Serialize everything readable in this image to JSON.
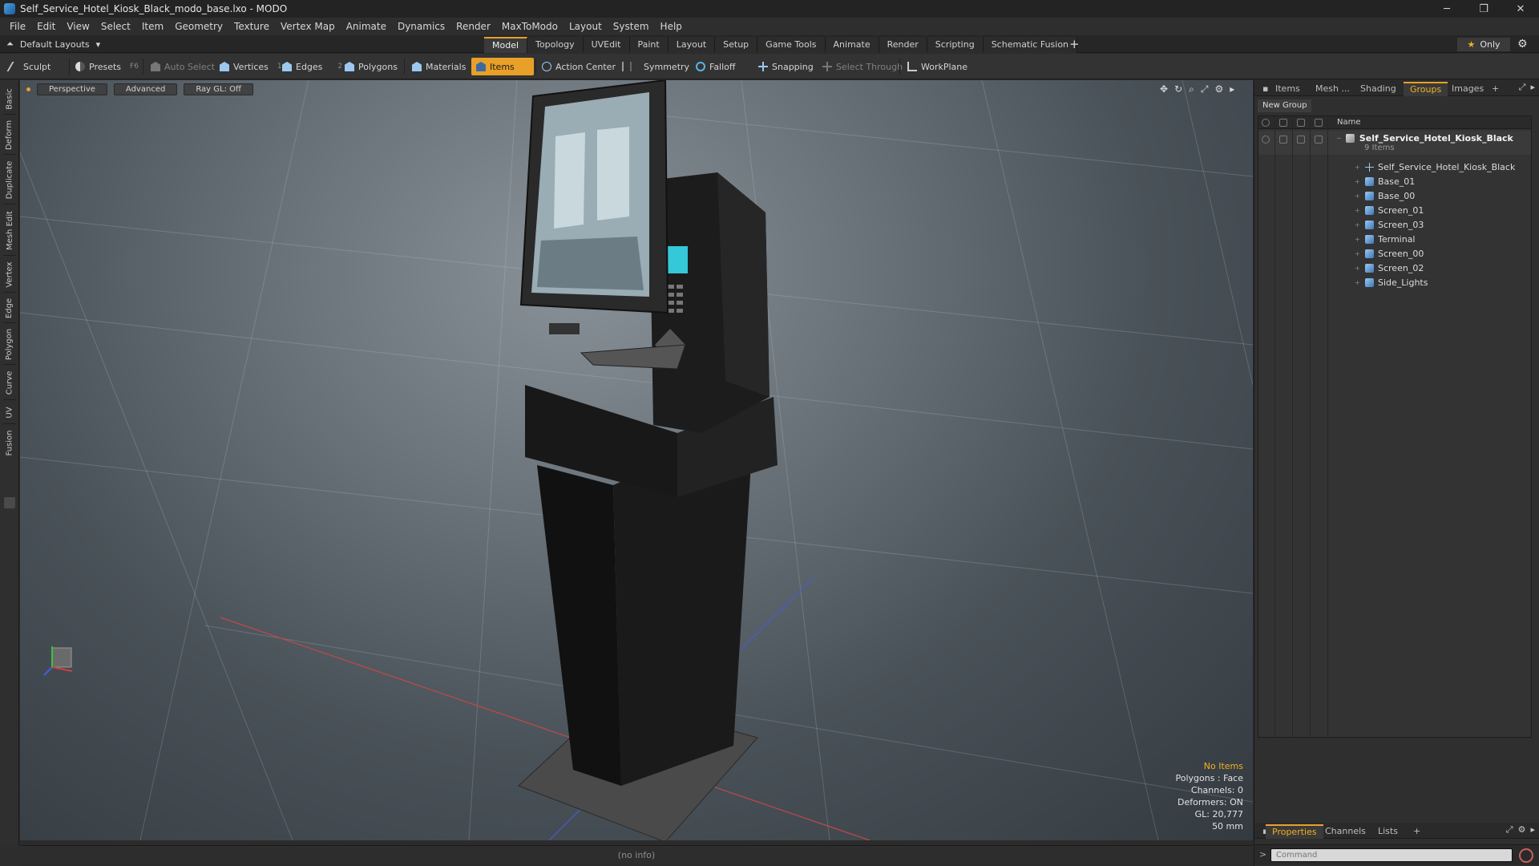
{
  "window": {
    "title": "Self_Service_Hotel_Kiosk_Black_modo_base.lxo - MODO",
    "minimize": "─",
    "maximize": "❐",
    "close": "✕"
  },
  "menu": [
    "File",
    "Edit",
    "View",
    "Select",
    "Item",
    "Geometry",
    "Texture",
    "Vertex Map",
    "Animate",
    "Dynamics",
    "Render",
    "MaxToModo",
    "Layout",
    "System",
    "Help"
  ],
  "layout_bar": {
    "layout_select": "Default Layouts",
    "tabs": [
      "Model",
      "Topology",
      "UVEdit",
      "Paint",
      "Layout",
      "Setup",
      "Game Tools",
      "Animate",
      "Render",
      "Scripting",
      "Schematic Fusion"
    ],
    "active_tab": "Model",
    "plus": "+",
    "only_label": "Only",
    "gear": "⚙"
  },
  "toolbar": {
    "sculpt": "Sculpt",
    "presets": "Presets",
    "presets_key": "F6",
    "auto_select": "Auto Select",
    "vertices": "Vertices",
    "vertices_key": "1",
    "edges": "Edges",
    "edges_key": "2",
    "polygons": "Polygons",
    "materials": "Materials",
    "items": "Items",
    "action_center": "Action Center",
    "symmetry": "Symmetry",
    "falloff": "Falloff",
    "snapping": "Snapping",
    "select_through": "Select Through",
    "workplane": "WorkPlane"
  },
  "left_tabs": [
    "Basic",
    "Deform",
    "Duplicate",
    "Mesh Edit",
    "Vertex",
    "Edge",
    "Polygon",
    "Curve",
    "UV",
    "Fusion"
  ],
  "viewport": {
    "view_mode": "Perspective",
    "shading": "Advanced",
    "raygl": "Ray GL: Off",
    "info": {
      "no_items": "No Items",
      "polygons": "Polygons : Face",
      "channels": "Channels: 0",
      "deformers": "Deformers: ON",
      "gl": "GL: 20,777",
      "focal": "50 mm"
    }
  },
  "status": "(no info)",
  "right_panel": {
    "top_tabs": [
      "Items",
      "Mesh ...",
      "Shading",
      "Groups",
      "Images"
    ],
    "active_top_tab": "Groups",
    "new_group": "New Group",
    "name_col": "Name",
    "group": {
      "name": "Self_Service_Hotel_Kiosk_Black",
      "count": "9 Items",
      "items": [
        {
          "name": "Self_Service_Hotel_Kiosk_Black",
          "type": "locator"
        },
        {
          "name": "Base_01",
          "type": "mesh"
        },
        {
          "name": "Base_00",
          "type": "mesh"
        },
        {
          "name": "Screen_01",
          "type": "mesh"
        },
        {
          "name": "Screen_03",
          "type": "mesh"
        },
        {
          "name": "Terminal",
          "type": "mesh"
        },
        {
          "name": "Screen_00",
          "type": "mesh"
        },
        {
          "name": "Screen_02",
          "type": "mesh"
        },
        {
          "name": "Side_Lights",
          "type": "mesh"
        }
      ]
    },
    "bottom_tabs": [
      "Properties",
      "Channels",
      "Lists"
    ],
    "active_bottom_tab": "Properties",
    "command_placeholder": "Command"
  },
  "colors": {
    "accent": "#e8a029",
    "warn_text": "#f0b020"
  }
}
